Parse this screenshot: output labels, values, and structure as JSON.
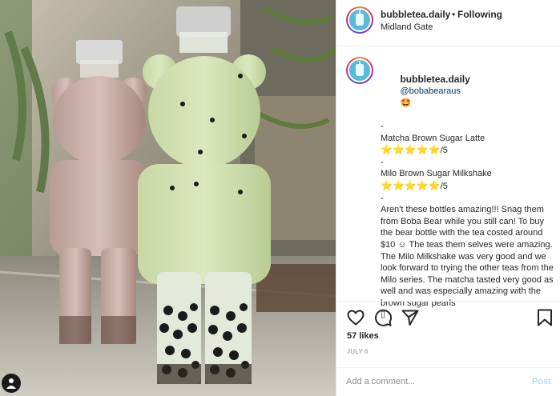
{
  "post": {
    "username": "bubbletea.daily",
    "follow_separator": "•",
    "follow_status": "Following",
    "location": "Midland Gate"
  },
  "caption": {
    "username": "bubbletea.daily",
    "mention": "@bobabearaus",
    "emoji": "🤩",
    "dash1": "-",
    "item1_name": "Matcha Brown Sugar Latte",
    "item1_stars": "⭐⭐⭐⭐⭐",
    "item1_score": "/5",
    "dash2": "-",
    "item2_name": "Milo Brown Sugar Milkshake",
    "item2_stars": "⭐⭐⭐⭐⭐",
    "item2_score": "/5",
    "dash3": "-",
    "body": "Aren't these bottles amazing!!! Snag them from Boba Bear while you still can! To buy the bear bottle with the tea costed around $10 ☺ The teas them selves were amazing. The Milo Milkshake was very good and we look forward to trying the other teas from the Milo series. The matcha tasted very good as well and was especially amazing with the brown sugar pearls",
    "trailing_glyph": "▯"
  },
  "actions": {
    "like_icon": "heart-icon",
    "comment_icon": "comment-icon",
    "share_icon": "send-icon",
    "save_icon": "bookmark-icon",
    "likes": "57 likes",
    "date": "JULY 6"
  },
  "comment": {
    "placeholder": "Add a comment...",
    "post_label": "Post"
  },
  "colors": {
    "post_button_disabled": "#b3dbff",
    "mention": "#00376b",
    "star": "#f2a900"
  }
}
